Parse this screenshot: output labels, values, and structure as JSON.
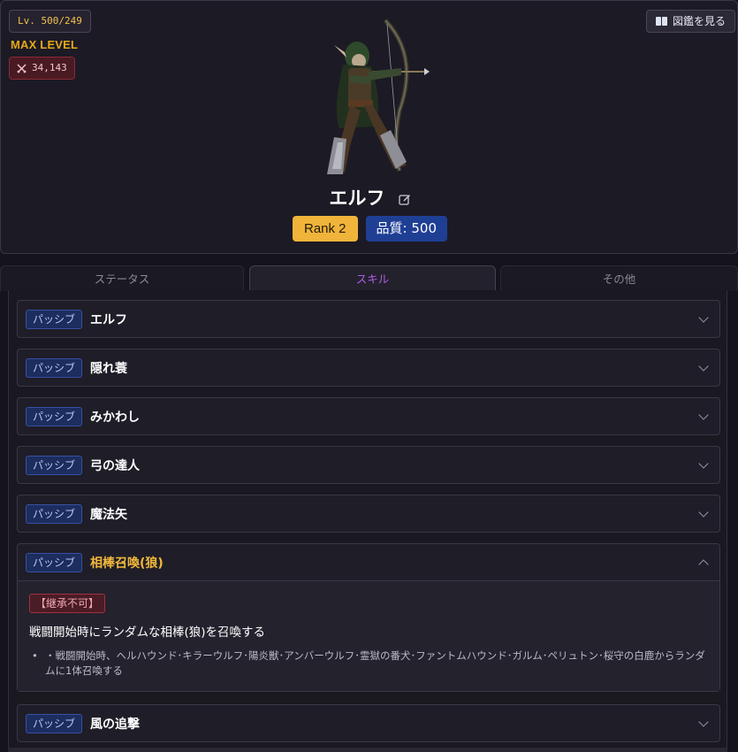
{
  "header": {
    "level": "Lv. 500/249",
    "max_level": "MAX LEVEL",
    "power": "34,143",
    "power_icon": "crossed-swords-icon",
    "zukan_button": "図鑑を見る"
  },
  "unit": {
    "name": "エルフ",
    "rank": "Rank 2",
    "quality": "品質: 500"
  },
  "tabs": [
    "ステータス",
    "スキル",
    "その他"
  ],
  "skills": [
    {
      "type": "パッシブ",
      "name": "エルフ"
    },
    {
      "type": "パッシブ",
      "name": "隠れ蓑"
    },
    {
      "type": "パッシブ",
      "name": "みかわし"
    },
    {
      "type": "パッシブ",
      "name": "弓の達人"
    },
    {
      "type": "パッシブ",
      "name": "魔法矢"
    },
    {
      "type": "パッシブ",
      "name": "相棒召喚(狼)",
      "inherit": "【継承不可】",
      "description": "戦闘開始時にランダムな相棒(狼)を召喚する",
      "bullet": "•",
      "detail": "・戦闘開始時、ヘルハウンド･キラーウルフ･陽炎獣･アンバーウルフ･霊獄の番犬･ファントムハウンド･ガルム･ペリュトン･桜守の白鹿からランダムに1体召喚する"
    },
    {
      "type": "パッシブ",
      "name": "風の追撃"
    }
  ],
  "colors": {
    "accent_purple": "#b05ce8",
    "rank_gold": "#f0b43a",
    "quality_blue": "#1f3f95",
    "max_level_gold": "#e5a91a"
  }
}
